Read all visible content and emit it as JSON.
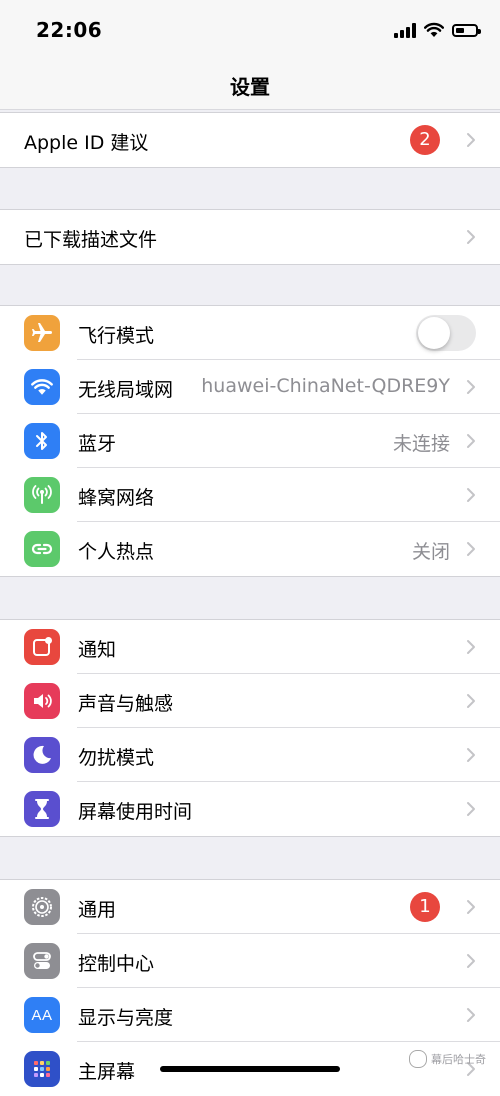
{
  "status": {
    "time": "22:06"
  },
  "nav": {
    "title": "设置"
  },
  "group1": {
    "rows": [
      {
        "label": "Apple ID 建议",
        "badge": "2"
      }
    ]
  },
  "group2": {
    "rows": [
      {
        "label": "已下载描述文件"
      }
    ]
  },
  "group3": {
    "rows": [
      {
        "label": "飞行模式",
        "icon": "airplane-icon",
        "icon_color": "#f0a23c",
        "toggle_on": false
      },
      {
        "label": "无线局域网",
        "value": "huawei-ChinaNet-QDRE9Y",
        "icon": "wifi-icon",
        "icon_color": "#2f7ff5"
      },
      {
        "label": "蓝牙",
        "value": "未连接",
        "icon": "bluetooth-icon",
        "icon_color": "#2f7ff5"
      },
      {
        "label": "蜂窝网络",
        "icon": "cellular-icon",
        "icon_color": "#5cc96b"
      },
      {
        "label": "个人热点",
        "value": "关闭",
        "icon": "hotspot-icon",
        "icon_color": "#5cc96b"
      }
    ]
  },
  "group4": {
    "rows": [
      {
        "label": "通知",
        "icon": "notification-icon",
        "icon_color": "#e8473e"
      },
      {
        "label": "声音与触感",
        "icon": "sound-icon",
        "icon_color": "#e63b5a"
      },
      {
        "label": "勿扰模式",
        "icon": "moon-icon",
        "icon_color": "#5a4fcf"
      },
      {
        "label": "屏幕使用时间",
        "icon": "hourglass-icon",
        "icon_color": "#5a4fcf"
      }
    ]
  },
  "group5": {
    "rows": [
      {
        "label": "通用",
        "badge": "1",
        "icon": "gear-icon",
        "icon_color": "#8e8e93"
      },
      {
        "label": "控制中心",
        "icon": "switches-icon",
        "icon_color": "#8e8e93"
      },
      {
        "label": "显示与亮度",
        "icon": "text-size-icon",
        "icon_color": "#2f7ff5",
        "icon_text": "AA"
      },
      {
        "label": "主屏幕",
        "icon": "home-screen-icon",
        "icon_color": "#2f50c8"
      }
    ]
  },
  "watermark": {
    "text": "幕后哈士奇"
  }
}
